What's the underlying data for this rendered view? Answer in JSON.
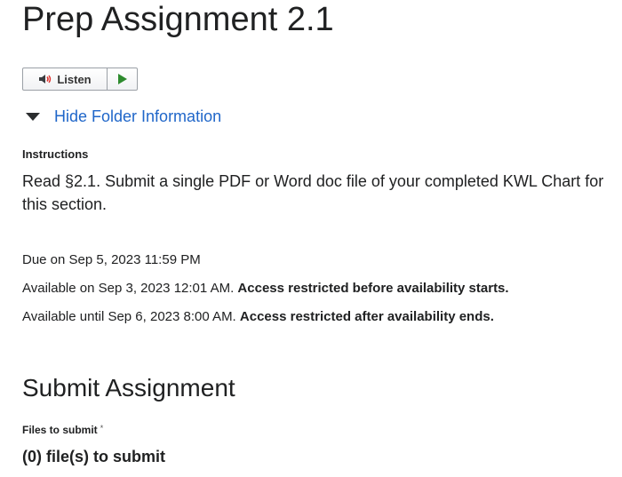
{
  "page": {
    "title": "Prep Assignment 2.1"
  },
  "listen": {
    "label": "Listen",
    "speaker_icon": "speaker-icon",
    "play_icon": "play-icon",
    "play_color": "#2e8b2e",
    "speaker_color": "#e0322d"
  },
  "folder_toggle": {
    "label": "Hide Folder Information",
    "icon": "caret-down-icon",
    "link_color": "#1f66c9"
  },
  "instructions": {
    "label": "Instructions",
    "text": "Read §2.1. Submit a single PDF or Word doc file of your completed KWL Chart for this section."
  },
  "dates": {
    "due": "Due on Sep 5, 2023 11:59 PM",
    "available_start": "Available on Sep 3, 2023 12:01 AM.",
    "available_start_note": "Access restricted before availability starts.",
    "available_end": "Available until Sep 6, 2023 8:00 AM.",
    "available_end_note": "Access restricted after availability ends."
  },
  "submit": {
    "heading": "Submit Assignment",
    "files_label": "Files to submit",
    "required_marker": "*",
    "files_count": "(0) file(s) to submit"
  }
}
